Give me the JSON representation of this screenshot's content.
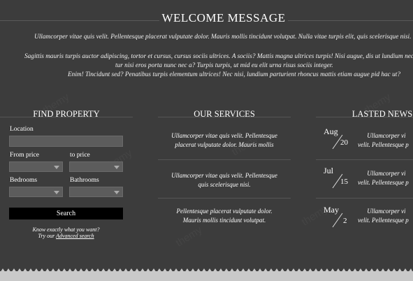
{
  "welcome": {
    "title": "WELCOME MESSAGE",
    "line1": "Ullamcorper vitae quis velit. Pellentesque placerat vulputate dolor. Mauris mollis tincidunt volutpat. Nulla vitae turpis elit, quis scelerisque nisi.",
    "line2": "Sagittis mauris turpis auctor adipiscing, tortor et cursus, cursus sociis ultrices. A sociis? Mattis magna ultrices turpis! Nisi augue, dis ut lundium nec,",
    "line3": "tur nisi eros porta nunc nec a? Turpis turpis, ut mid eu elit urna risus sociis integer.",
    "line4": "Enim! Tincidunt sed? Penatibus turpis elementum ultrices! Nec nisi, lundium parturient rhoncus mattis etiam augue pid hac ut?"
  },
  "find": {
    "title": "FIND PROPERTY",
    "location_label": "Location",
    "location_value": "",
    "from_price_label": "From price",
    "to_price_label": "to price",
    "from_price_value": "",
    "to_price_value": "",
    "bedrooms_label": "Bedrooms",
    "bathrooms_label": "Bathrooms",
    "bedrooms_value": "",
    "bathrooms_value": "",
    "search_label": "Search",
    "note_line1": "Know exactly what you want?",
    "note_prefix": "Try our ",
    "advanced_link": "Advanced search"
  },
  "services": {
    "title": "OUR SERVICES",
    "items": [
      {
        "line1": "Ullamcorper vitae quis velit. Pellentesque",
        "line2": "placerat vulputate dolor. Mauris mollis"
      },
      {
        "line1": "Ullamcorper vitae quis velit. Pellentesque",
        "line2": "quis scelerisque nisi."
      },
      {
        "line1": "Pellentesque placerat vulputate dolor.",
        "line2": "Mauris mollis tincidunt volutpat."
      }
    ]
  },
  "news": {
    "title": "LASTED NEWS",
    "items": [
      {
        "month": "Aug",
        "day": "20",
        "line1": "Ullamcorper vi",
        "line2": "velit. Pellentesque p"
      },
      {
        "month": "Jul",
        "day": "15",
        "line1": "Ullamcorper vi",
        "line2": "velit. Pellentesque p"
      },
      {
        "month": "May",
        "day": "2",
        "line1": "Ullamcorper vi",
        "line2": "velit. Pellentesque p"
      }
    ]
  },
  "colors": {
    "background": "#3c3c3c",
    "field": "#5c5c5c",
    "button": "#000000",
    "footer": "#c9c9c9"
  }
}
